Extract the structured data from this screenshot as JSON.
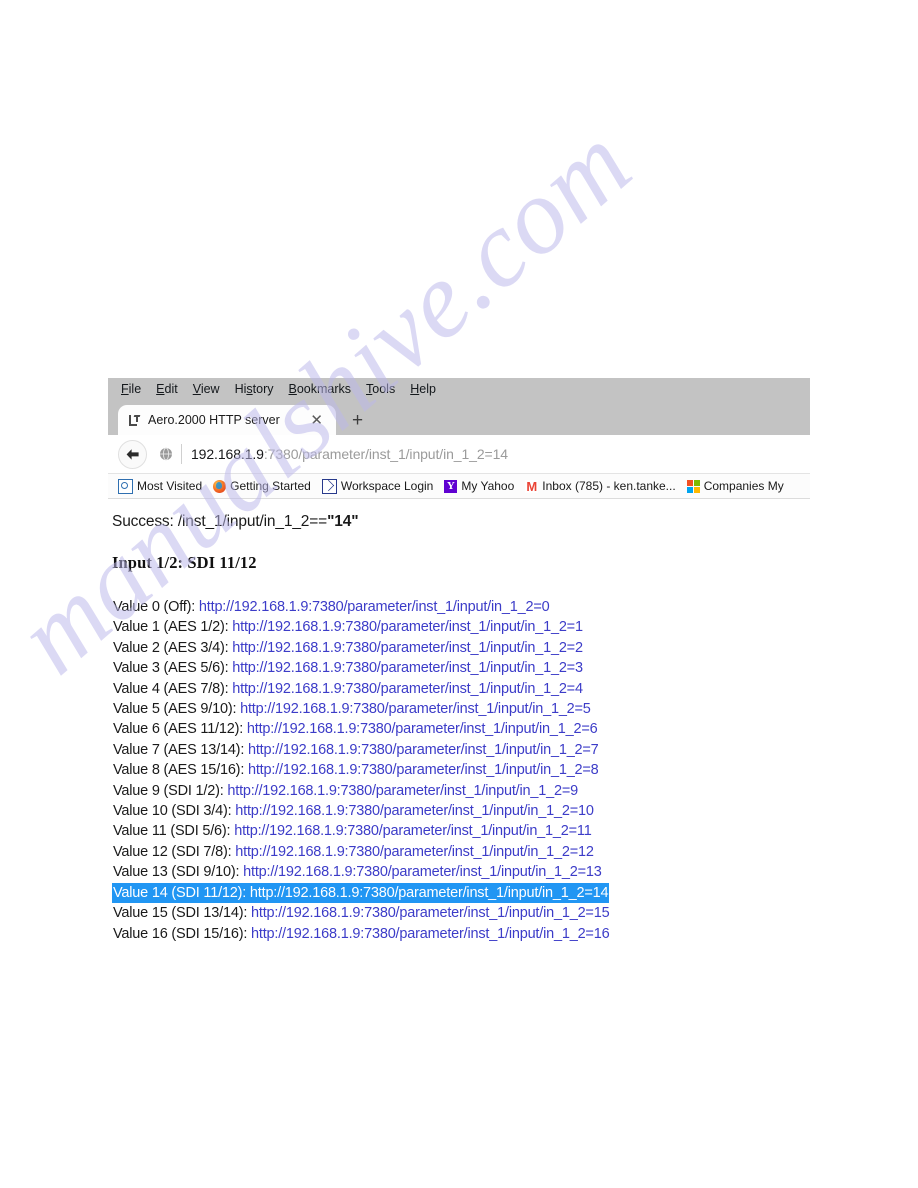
{
  "browser": {
    "menu": [
      {
        "accel": "F",
        "rest": "ile"
      },
      {
        "accel": "E",
        "rest": "dit"
      },
      {
        "accel": "V",
        "rest": "iew"
      },
      {
        "accel": "His",
        "rest": "tory",
        "pre": "Hi",
        "mid": "s",
        "post": "tory"
      },
      {
        "accel": "B",
        "rest": "ookmarks"
      },
      {
        "accel": "T",
        "rest": "ools"
      },
      {
        "accel": "H",
        "rest": "elp"
      }
    ],
    "menu_labels": {
      "file": "File",
      "edit": "Edit",
      "view": "View",
      "history": "History",
      "bookmarks": "Bookmarks",
      "tools": "Tools",
      "help": "Help"
    },
    "tab": {
      "title": "Aero.2000 HTTP server",
      "close_label": "✕",
      "new_tab_label": "+"
    },
    "url": {
      "host": "192.168.1.9",
      "path": ":7380/parameter/inst_1/input/in_1_2=14",
      "full": "192.168.1.9:7380/parameter/inst_1/input/in_1_2=14"
    },
    "bookmarks": [
      {
        "label": "Most Visited",
        "icon": "most-visited-icon"
      },
      {
        "label": "Getting Started",
        "icon": "firefox-icon"
      },
      {
        "label": "Workspace Login",
        "icon": "envelope-icon"
      },
      {
        "label": "My Yahoo",
        "icon": "yahoo-icon",
        "glyph": "Y"
      },
      {
        "label": "Inbox (785) - ken.tanke...",
        "icon": "gmail-icon",
        "glyph": "M"
      },
      {
        "label": "Companies My",
        "icon": "microsoft-icon"
      }
    ]
  },
  "content": {
    "success_prefix": "Success: /inst_1/input/in_1_2==",
    "success_value": "\"14\"",
    "heading": "Input 1/2: SDI 11/12",
    "values": [
      {
        "label": "Value 0 (Off): ",
        "link": "http://192.168.1.9:7380/parameter/inst_1/input/in_1_2=0",
        "selected": false
      },
      {
        "label": "Value 1 (AES 1/2): ",
        "link": "http://192.168.1.9:7380/parameter/inst_1/input/in_1_2=1",
        "selected": false
      },
      {
        "label": "Value 2 (AES 3/4): ",
        "link": "http://192.168.1.9:7380/parameter/inst_1/input/in_1_2=2",
        "selected": false
      },
      {
        "label": "Value 3 (AES 5/6): ",
        "link": "http://192.168.1.9:7380/parameter/inst_1/input/in_1_2=3",
        "selected": false
      },
      {
        "label": "Value 4 (AES 7/8): ",
        "link": "http://192.168.1.9:7380/parameter/inst_1/input/in_1_2=4",
        "selected": false
      },
      {
        "label": "Value 5 (AES 9/10): ",
        "link": "http://192.168.1.9:7380/parameter/inst_1/input/in_1_2=5",
        "selected": false
      },
      {
        "label": "Value 6 (AES 11/12): ",
        "link": "http://192.168.1.9:7380/parameter/inst_1/input/in_1_2=6",
        "selected": false
      },
      {
        "label": "Value 7 (AES 13/14): ",
        "link": "http://192.168.1.9:7380/parameter/inst_1/input/in_1_2=7",
        "selected": false
      },
      {
        "label": "Value 8 (AES 15/16): ",
        "link": "http://192.168.1.9:7380/parameter/inst_1/input/in_1_2=8",
        "selected": false
      },
      {
        "label": "Value 9 (SDI 1/2): ",
        "link": "http://192.168.1.9:7380/parameter/inst_1/input/in_1_2=9",
        "selected": false
      },
      {
        "label": "Value 10 (SDI 3/4): ",
        "link": "http://192.168.1.9:7380/parameter/inst_1/input/in_1_2=10",
        "selected": false
      },
      {
        "label": "Value 11 (SDI 5/6): ",
        "link": "http://192.168.1.9:7380/parameter/inst_1/input/in_1_2=11",
        "selected": false
      },
      {
        "label": "Value 12 (SDI 7/8): ",
        "link": "http://192.168.1.9:7380/parameter/inst_1/input/in_1_2=12",
        "selected": false
      },
      {
        "label": "Value 13 (SDI 9/10): ",
        "link": "http://192.168.1.9:7380/parameter/inst_1/input/in_1_2=13",
        "selected": false
      },
      {
        "label": "Value 14 (SDI 11/12): ",
        "link": "http://192.168.1.9:7380/parameter/inst_1/input/in_1_2=14",
        "selected": true
      },
      {
        "label": "Value 15 (SDI 13/14): ",
        "link": "http://192.168.1.9:7380/parameter/inst_1/input/in_1_2=15",
        "selected": false
      },
      {
        "label": "Value 16 (SDI 15/16): ",
        "link": "http://192.168.1.9:7380/parameter/inst_1/input/in_1_2=16",
        "selected": false
      }
    ]
  },
  "watermark": {
    "text": "manualshive.com"
  },
  "colors": {
    "selection_background": "#2196f3",
    "selection_text": "#ffffff",
    "link": "#3c3cc8",
    "chrome_gray": "#c3c3c3",
    "watermark": "#bcb8ea"
  }
}
